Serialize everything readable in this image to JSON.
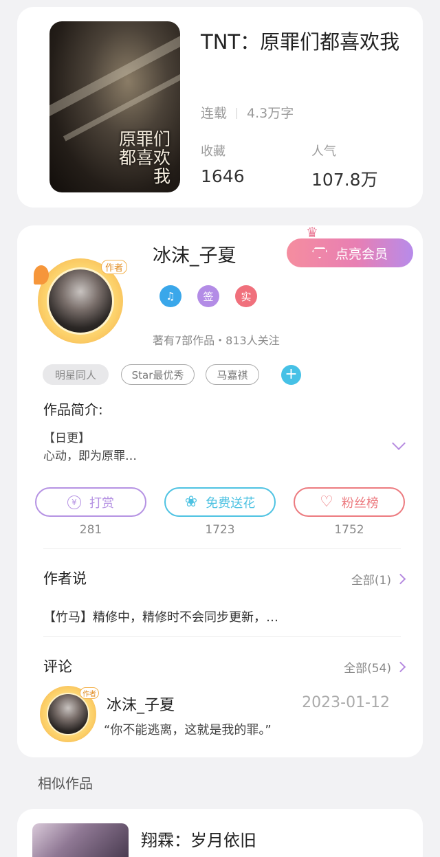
{
  "book": {
    "cover_text": "原罪们都喜欢我",
    "title": "TNT：原罪们都喜欢我",
    "status": "连载",
    "word_count": "4.3万字",
    "favorites_label": "收藏",
    "favorites_value": "1646",
    "popularity_label": "人气",
    "popularity_value": "107.8万"
  },
  "author": {
    "name": "冰沫_子夏",
    "avatar_tag": "作者",
    "vip_button": "点亮会员",
    "badges": [
      {
        "label": "♫",
        "color": "#3aa7ea"
      },
      {
        "label": "签",
        "color": "#b38ce6"
      },
      {
        "label": "实",
        "color": "#f0707c"
      }
    ],
    "meta": "著有7部作品・813人关注",
    "tags": [
      "明星同人",
      "Star最优秀",
      "马嘉祺"
    ],
    "tag_add": "+"
  },
  "intro": {
    "label": "作品简介:",
    "line1": "【日更】",
    "line2": "心动，即为原罪…"
  },
  "actions": [
    {
      "icon": "¥",
      "label": "打赏",
      "count": "281",
      "color": "#b592e3"
    },
    {
      "icon": "❀",
      "label": "免费送花",
      "count": "1723",
      "color": "#4dc2e2"
    },
    {
      "icon": "♡",
      "label": "粉丝榜",
      "count": "1752",
      "color": "#ec7a7f"
    }
  ],
  "author_say": {
    "title": "作者说",
    "more": "全部(1)",
    "text": "【竹马】精修中，精修时不会同步更新，…"
  },
  "comments": {
    "title": "评论",
    "more": "全部(54)",
    "user": "冰沫_子夏",
    "avatar_tag": "作者",
    "date": "2023-01-12",
    "text": "“你不能逃离，这就是我的罪。”"
  },
  "similar": {
    "label": "相似作品",
    "title": "翔霖：岁月依旧"
  }
}
